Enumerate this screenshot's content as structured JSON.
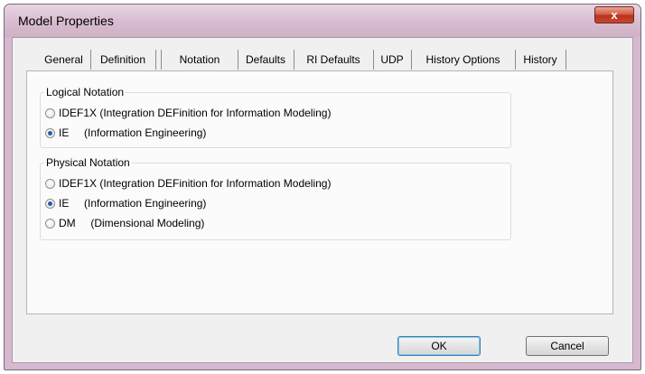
{
  "window": {
    "title": "Model Properties",
    "close_glyph": "x"
  },
  "tabs": [
    {
      "label": "General"
    },
    {
      "label": "Definition"
    },
    {
      "label": "Notation"
    },
    {
      "label": "Defaults"
    },
    {
      "label": "RI Defaults"
    },
    {
      "label": "UDP"
    },
    {
      "label": "History Options"
    },
    {
      "label": "History"
    }
  ],
  "active_tab": "Notation",
  "logical": {
    "label": "Logical Notation",
    "options": [
      {
        "label": "IDEF1X (Integration DEFinition for Information Modeling)",
        "selected": false
      },
      {
        "label": "IE     (Information Engineering)",
        "selected": true
      }
    ]
  },
  "physical": {
    "label": "Physical Notation",
    "options": [
      {
        "label": "IDEF1X (Integration DEFinition for Information Modeling)",
        "selected": false
      },
      {
        "label": "IE     (Information Engineering)",
        "selected": true
      },
      {
        "label": "DM     (Dimensional Modeling)",
        "selected": false
      }
    ]
  },
  "buttons": {
    "ok": "OK",
    "cancel": "Cancel"
  }
}
